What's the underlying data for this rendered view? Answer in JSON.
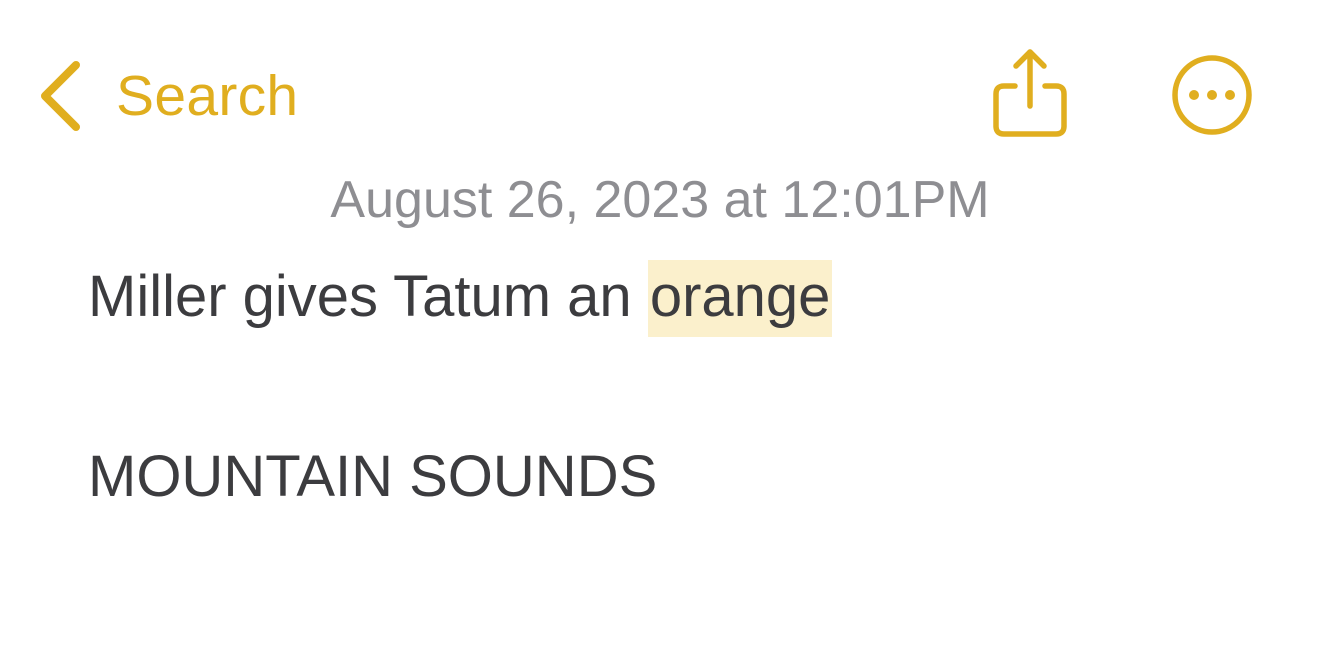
{
  "colors": {
    "accent": "#E0AE1F",
    "date_text": "#8E8E92",
    "body_text": "#3C3C3F",
    "highlight": "#FBF0CC"
  },
  "nav": {
    "back_label": "Search",
    "back_icon": "chevron-left-icon",
    "share_icon": "share-icon",
    "more_icon": "ellipsis-circle-icon"
  },
  "note": {
    "date": "August 26, 2023 at 12:01PM",
    "line1_prefix": "Miller gives Tatum an ",
    "line1_highlight": "orange",
    "line2": "MOUNTAIN SOUNDS"
  }
}
